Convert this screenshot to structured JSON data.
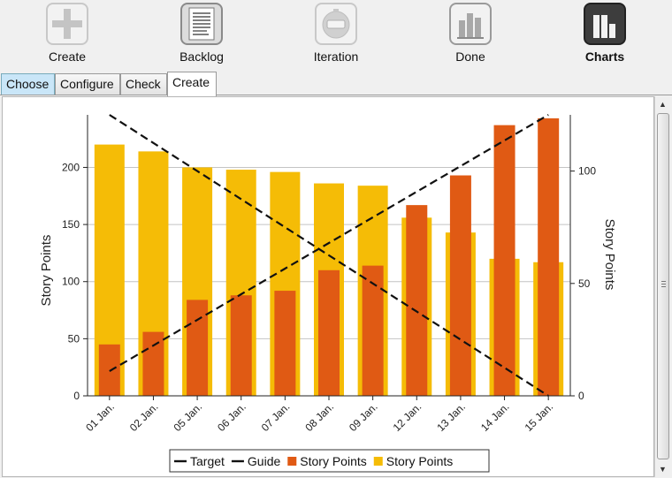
{
  "toolbar": {
    "items": [
      {
        "label": "Create",
        "icon": "plus-icon",
        "active": false
      },
      {
        "label": "Backlog",
        "icon": "document-list-icon",
        "active": false
      },
      {
        "label": "Iteration",
        "icon": "timer-icon",
        "active": false
      },
      {
        "label": "Done",
        "icon": "bar-chart-gray-icon",
        "active": false
      },
      {
        "label": "Charts",
        "icon": "bar-chart-dark-icon",
        "active": true
      }
    ]
  },
  "tabs": [
    {
      "label": "Choose",
      "state": "hover"
    },
    {
      "label": "Configure",
      "state": "normal"
    },
    {
      "label": "Check",
      "state": "normal"
    },
    {
      "label": "Create",
      "state": "active"
    }
  ],
  "colors": {
    "bar_orange": "#e05a14",
    "bar_yellow": "#f5bc06",
    "line": "#111111",
    "grid": "#c4c4c4",
    "tab_hover": "#c9e6f8"
  },
  "chart_data": {
    "type": "bar",
    "categories": [
      "01 Jan.",
      "02 Jan.",
      "05 Jan.",
      "06 Jan.",
      "07 Jan.",
      "08 Jan.",
      "09 Jan.",
      "12 Jan.",
      "13 Jan.",
      "14 Jan.",
      "15 Jan."
    ],
    "ylabel": "Story Points",
    "y2label": "Story Points",
    "ylim": [
      0,
      246
    ],
    "y2lim": [
      0,
      125
    ],
    "yticks": [
      0,
      50,
      100,
      150,
      200
    ],
    "y2ticks": [
      0,
      50,
      100
    ],
    "grid": true,
    "legend_position": "bottom",
    "series": [
      {
        "name": "Story Points",
        "kind": "bar-wide",
        "color": "#f5bc06",
        "values": [
          220,
          214,
          200,
          198,
          196,
          186,
          184,
          156,
          143,
          120,
          117
        ]
      },
      {
        "name": "Story Points",
        "kind": "bar-narrow",
        "color": "#e05a14",
        "values": [
          45,
          56,
          84,
          88,
          92,
          110,
          114,
          167,
          193,
          237,
          243
        ]
      },
      {
        "name": "Target",
        "kind": "line-dashed",
        "axis": "right",
        "values": [
          125,
          112.5,
          100,
          87.5,
          75,
          62.5,
          50,
          37.5,
          25,
          12.5,
          0
        ]
      },
      {
        "name": "Guide",
        "kind": "line-dashed",
        "axis": "right",
        "values": [
          11,
          22.4,
          33.8,
          45.2,
          56.6,
          68,
          79.4,
          90.8,
          102.2,
          113.6,
          125
        ]
      }
    ],
    "legend": [
      {
        "label": "Target",
        "swatch": "dash"
      },
      {
        "label": "Guide",
        "swatch": "dash"
      },
      {
        "label": "Story Points",
        "swatch": "square",
        "color": "#e05a14"
      },
      {
        "label": "Story Points",
        "swatch": "square",
        "color": "#f5bc06"
      }
    ]
  }
}
